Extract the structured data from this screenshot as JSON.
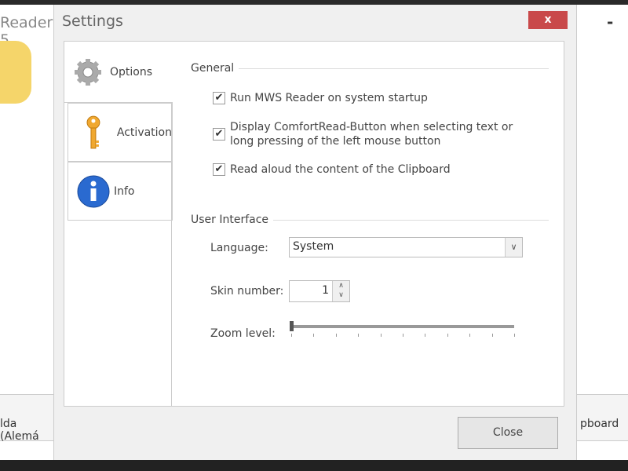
{
  "background": {
    "left_title": "Reader 5",
    "left_row": "lda (Alemá",
    "right_row": "pboard",
    "minimize": "-"
  },
  "dialog": {
    "title": "Settings",
    "close_x": "x",
    "tabs": [
      {
        "label": "Options",
        "icon": "gear-icon",
        "selected": true
      },
      {
        "label": "Activation",
        "icon": "key-icon"
      },
      {
        "label": "Info",
        "icon": "info-icon"
      }
    ],
    "general": {
      "heading": "General",
      "options": [
        {
          "label": "Run MWS Reader on system startup",
          "checked": true
        },
        {
          "label": "Display ComfortRead-Button when selecting text or long pressing of the left mouse button",
          "checked": true
        },
        {
          "label": "Read aloud the content of the Clipboard",
          "checked": true
        }
      ]
    },
    "ui": {
      "heading": "User Interface",
      "language_label": "Language:",
      "language_value": "System",
      "skin_label": "Skin number:",
      "skin_value": "1",
      "zoom_label": "Zoom level:",
      "zoom_value": 0,
      "zoom_ticks": 11
    },
    "close_button": "Close"
  },
  "colors": {
    "close_x": "#c9494a"
  }
}
